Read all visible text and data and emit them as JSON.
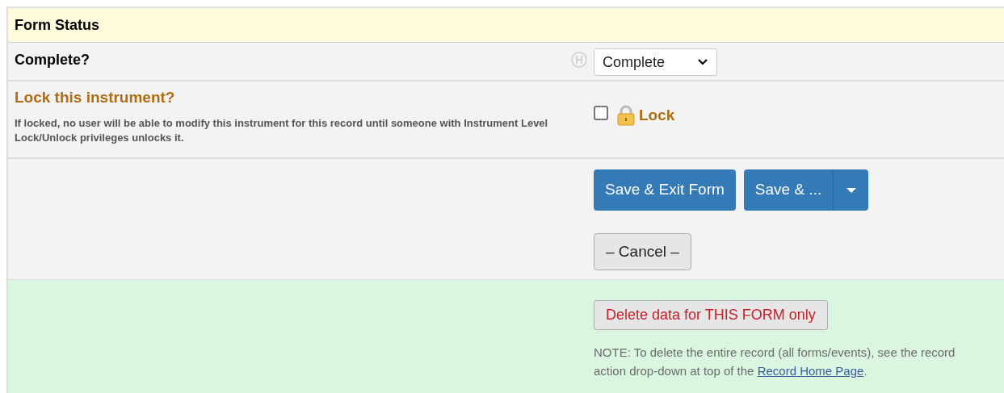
{
  "section_title": "Form Status",
  "complete_field": {
    "label": "Complete?",
    "value": "Complete"
  },
  "lock_field": {
    "label": "Lock this instrument?",
    "description": "If locked, no user will be able to modify this instrument for this record until someone with Instrument Level Lock/Unlock privileges unlocks it.",
    "checkbox_label": "Lock",
    "checked": false
  },
  "buttons": {
    "save_exit": "Save & Exit Form",
    "save_more": "Save & ...",
    "cancel": "– Cancel –"
  },
  "delete": {
    "button": "Delete data for THIS FORM only",
    "note": "NOTE: To delete the entire record (all forms/events), see the record action drop-down at top of the ",
    "link": "Record Home Page",
    "note_end": "."
  }
}
